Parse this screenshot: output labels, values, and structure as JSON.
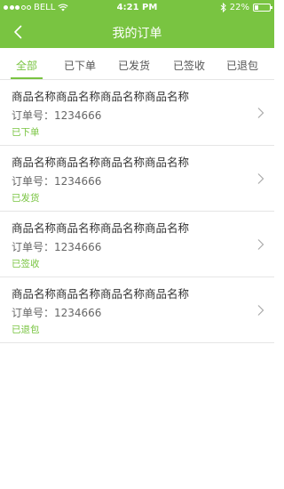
{
  "status_bar": {
    "carrier": "BELL",
    "time": "4:21 PM",
    "battery": "22%",
    "battery_level": 0.22
  },
  "nav": {
    "title": "我的订单",
    "back_icon": "chevron-left-icon"
  },
  "tabs": [
    {
      "label": "全部",
      "active": true
    },
    {
      "label": "已下单",
      "active": false
    },
    {
      "label": "已发货",
      "active": false
    },
    {
      "label": "已签收",
      "active": false
    },
    {
      "label": "已退包",
      "active": false
    }
  ],
  "orders": [
    {
      "name": "商品名称商品名称商品名称商品名称",
      "number": "订单号：1234666",
      "status": "已下单"
    },
    {
      "name": "商品名称商品名称商品名称商品名称",
      "number": "订单号：1234666",
      "status": "已发货"
    },
    {
      "name": "商品名称商品名称商品名称商品名称",
      "number": "订单号：1234666",
      "status": "已签收"
    },
    {
      "name": "商品名称商品名称商品名称商品名称",
      "number": "订单号：1234666",
      "status": "已退包"
    }
  ],
  "colors": {
    "accent": "#79c441",
    "divider": "#e5e5e5"
  }
}
